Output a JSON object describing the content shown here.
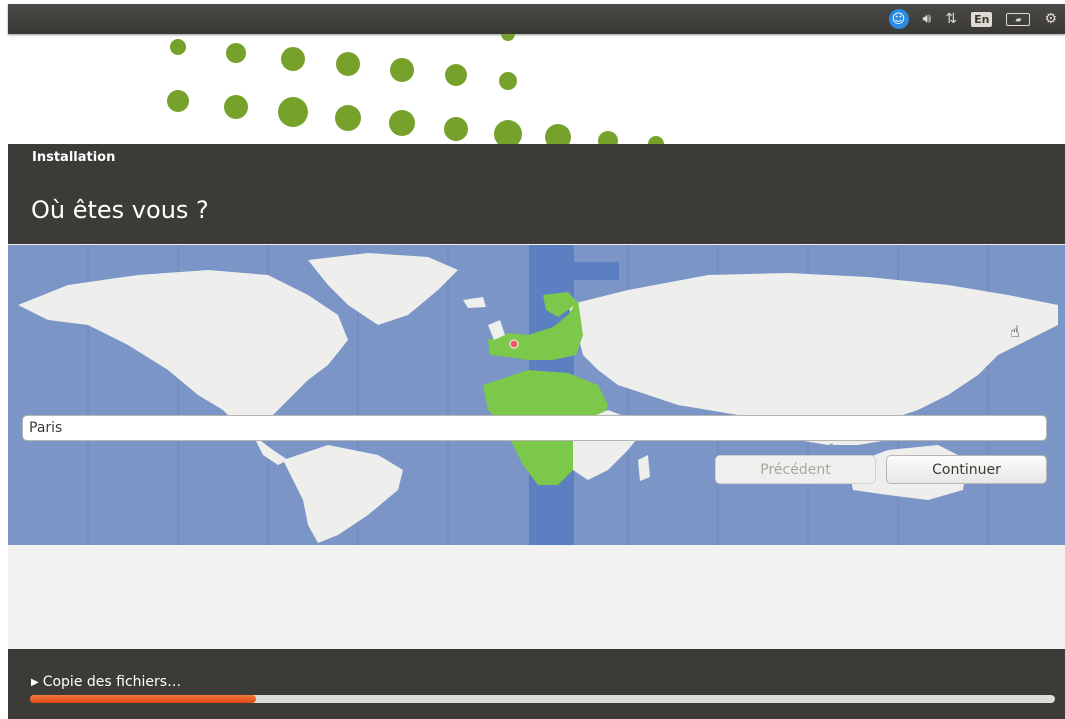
{
  "panel": {
    "accessibility_icon": "accessibility-icon",
    "sound_icon": "speaker-icon",
    "network_icon": "network-arrows-icon",
    "language_label": "En",
    "battery_icon": "battery-icon",
    "power_icon": "power-gear-icon"
  },
  "window": {
    "title": "Installation",
    "question": "Où êtes vous ?"
  },
  "map": {
    "selected_timezone_color": "#5b7fc0",
    "highlight_country_color": "#7cc84a",
    "land_color": "#eeeeec",
    "ocean_color": "#7a95c6"
  },
  "location": {
    "city_value": "Paris"
  },
  "buttons": {
    "previous_label": "Précédent",
    "continue_label": "Continuer"
  },
  "footer": {
    "status": "Copie des fichiers…",
    "progress": 0.22
  },
  "colors": {
    "accent": "#dd4814",
    "header_bg": "#3c3b37",
    "dot_green": "#76a12b"
  }
}
